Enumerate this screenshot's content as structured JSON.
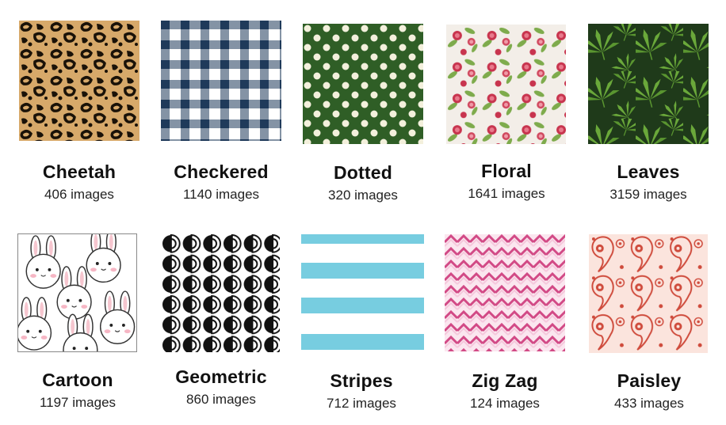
{
  "patterns": [
    {
      "name": "Cheetah",
      "count": "406 images",
      "pattern_icon": "cheetah-spots"
    },
    {
      "name": "Checkered",
      "count": "1140 images",
      "pattern_icon": "gingham-check"
    },
    {
      "name": "Dotted",
      "count": "320 images",
      "pattern_icon": "polka-dots"
    },
    {
      "name": "Floral",
      "count": "1641 images",
      "pattern_icon": "rose-print"
    },
    {
      "name": "Leaves",
      "count": "3159 images",
      "pattern_icon": "cannabis-leaves"
    },
    {
      "name": "Cartoon",
      "count": "1197 images",
      "pattern_icon": "bunny-faces"
    },
    {
      "name": "Geometric",
      "count": "860 images",
      "pattern_icon": "half-circles"
    },
    {
      "name": "Stripes",
      "count": "712 images",
      "pattern_icon": "horizontal-stripes"
    },
    {
      "name": "Zig Zag",
      "count": "124 images",
      "pattern_icon": "chevron-zigzag"
    },
    {
      "name": "Paisley",
      "count": "433 images",
      "pattern_icon": "paisley-print"
    }
  ],
  "colors": {
    "cheetah_bg": "#d7a96a",
    "cheetah_spot": "#1a1208",
    "check_dark": "#1f3a5a",
    "check_mid": "#7f93a8",
    "dot_bg": "#2f5e26",
    "dot_fg": "#f3f0dc",
    "floral_bg": "#f3eee8",
    "floral_rose": "#c8344e",
    "floral_leaf": "#7eab4c",
    "leaves_bg": "#1f3a1a",
    "leaves_leaf": "#6aa83a",
    "stripe_blue": "#77cde0",
    "zig_pink": "#d24a86",
    "zig_light": "#f5c8dc",
    "paisley_bg": "#fbe4dd",
    "paisley_red": "#cf4b3c"
  }
}
